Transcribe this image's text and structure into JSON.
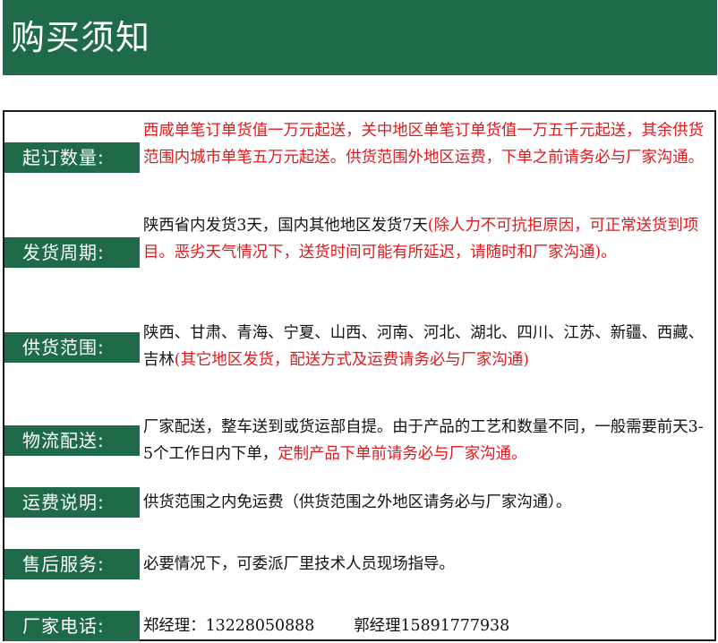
{
  "header": {
    "title": "购买须知"
  },
  "rows": {
    "order_qty": {
      "label": "起订数量:",
      "text_red": "西咸单笔订单货值一万元起送，关中地区单笔订单货值一万五千元起送，其余供货范围内城市单笔五万元起送。供货范围外地区运费，下单之前请务必与厂家沟通。"
    },
    "delivery_period": {
      "label": "发货周期:",
      "text_black": "陕西省内发货3天，国内其他地区发货7天",
      "text_red": "(除人力不可抗拒原因，可正常送货到项目。恶劣天气情况下，送货时间可能有所延迟，请随时和厂家沟通)。"
    },
    "supply_area": {
      "label": "供货范围:",
      "text_black": "陕西、甘肃、青海、宁夏、山西、河南、河北、湖北、四川、江苏、新疆、西藏、吉林",
      "text_red": "(其它地区发货，配送方式及运费请务必与厂家沟通)"
    },
    "logistics": {
      "label": "物流配送:",
      "text_black": "厂家配送，整车送到或货运部自提。由于产品的工艺和数量不同，一般需要前天3-5个工作日内下单，",
      "text_red": "定制产品下单前请务必与厂家沟通。"
    },
    "shipping_fee": {
      "label": "运费说明:",
      "text_black": "供货范围之内免运费（供货范围之外地区请务必与厂家沟通）。"
    },
    "after_sales": {
      "label": "售后服务:",
      "text_black": "必要情况下，可委派厂里技术人员现场指导。"
    },
    "phone": {
      "label": "厂家电话:",
      "contact1": "郑经理：13228050888",
      "contact2": "郭经理15891777938"
    }
  },
  "colors": {
    "brand_green": "#1f6b49",
    "alert_red": "#e0191e"
  }
}
